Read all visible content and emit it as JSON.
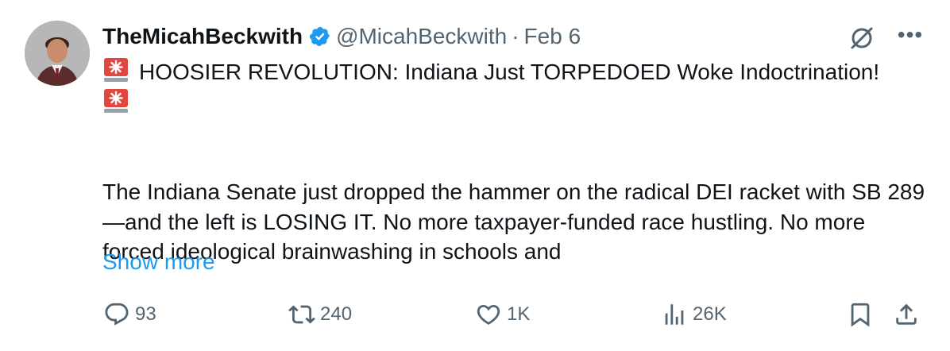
{
  "tweet": {
    "author_name": "TheMicahBeckwith",
    "handle": "@MicahBeckwith",
    "separator": "·",
    "date": "Feb 6",
    "headline": "HOOSIER REVOLUTION: Indiana Just TORPEDOED Woke Indoctrination!",
    "body_line1": "The Indiana Senate just dropped the hammer on the radical DEI racket with SB 289—and the left is LOSING IT. No more taxpayer-funded race hustling. No more forced ideological brainwashing in schools and",
    "show_more": "Show more"
  },
  "metrics": {
    "replies": "93",
    "reposts": "240",
    "likes": "1K",
    "views": "26K"
  },
  "colors": {
    "text": "#0f1419",
    "secondary": "#536471",
    "link": "#1d9bf0",
    "verified": "#1d9bf0"
  },
  "icons": [
    "verified-badge-icon",
    "grok-icon",
    "more-icon",
    "siren-icon",
    "reply-icon",
    "retweet-icon",
    "like-icon",
    "views-icon",
    "bookmark-icon",
    "share-icon"
  ]
}
